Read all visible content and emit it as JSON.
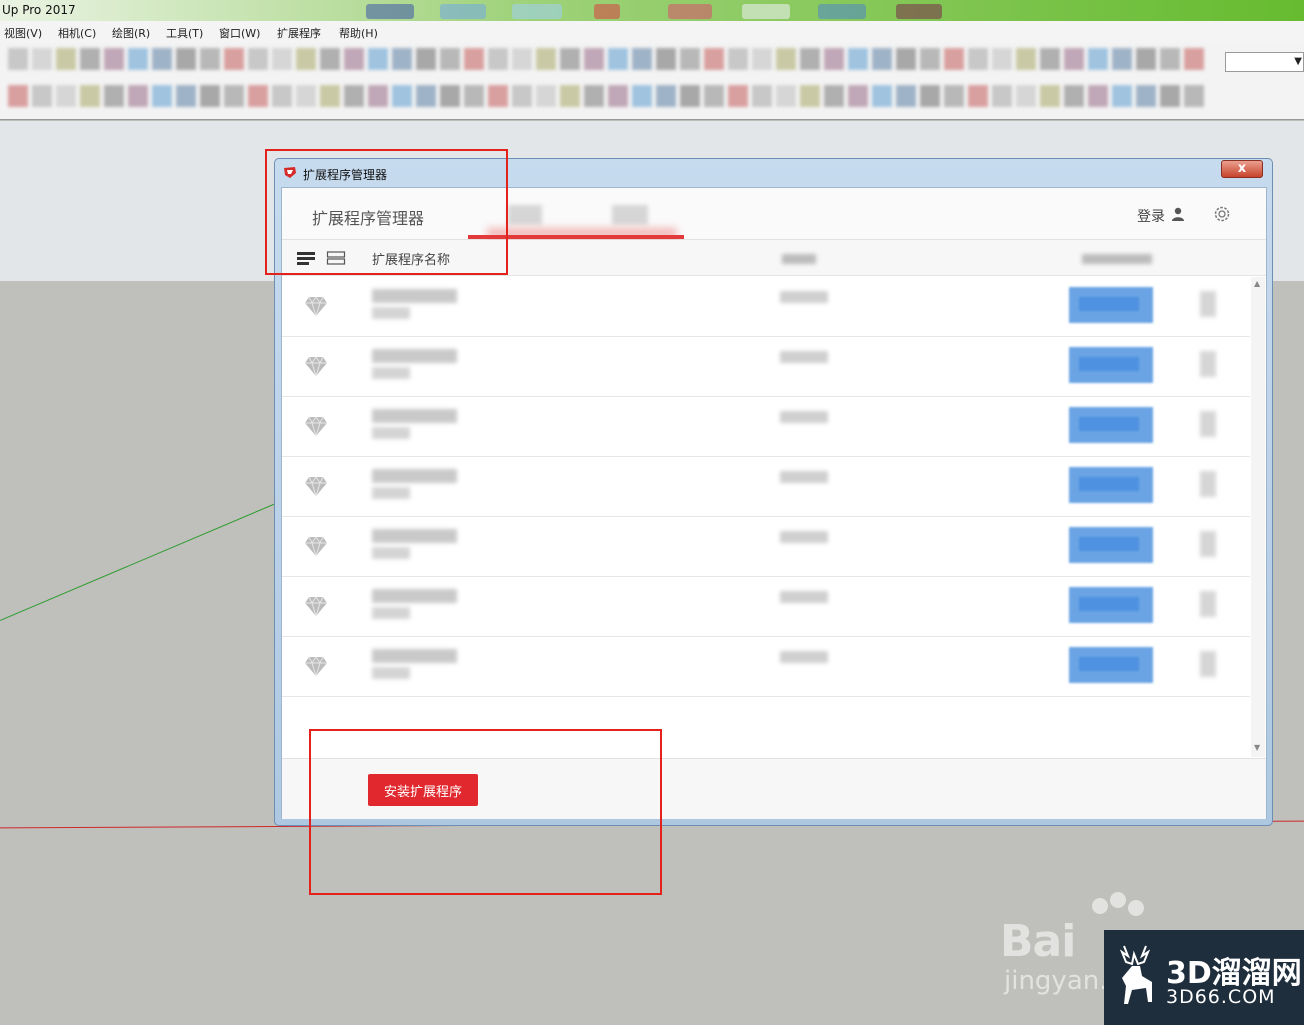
{
  "app": {
    "title": "Up Pro 2017"
  },
  "menubar": {
    "items": [
      "视图(V)",
      "相机(C)",
      "绘图(R)",
      "工具(T)",
      "窗口(W)",
      "扩展程序",
      "帮助(H)"
    ]
  },
  "dialog": {
    "title": "扩展程序管理器",
    "close_label": "x",
    "header_title": "扩展程序管理器",
    "login_label": "登录",
    "column_name": "扩展程序名称",
    "install_button": "安装扩展程序",
    "row_count": 7
  },
  "watermark": {
    "baidu": "Bai",
    "jingyan": "jingyan.",
    "site_cn": "3D溜溜网",
    "site_en": "3D66.COM"
  },
  "colors": {
    "accent_red": "#e0282e",
    "link_blue": "#6aa4e4",
    "annotation_red": "#e3221b"
  }
}
